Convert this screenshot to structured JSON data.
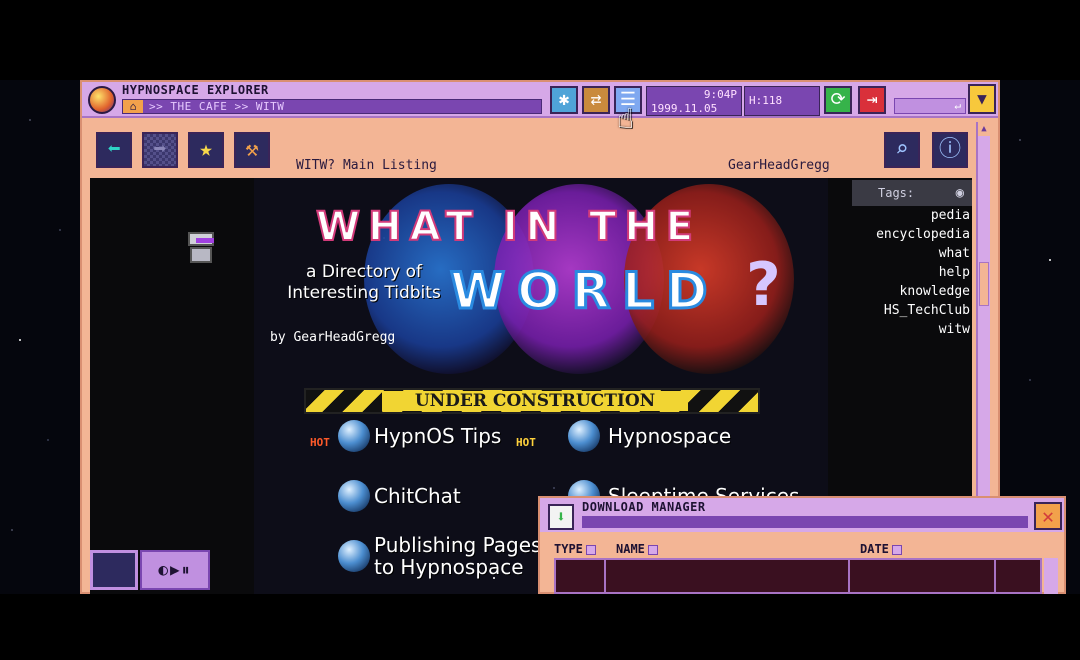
{
  "window": {
    "app_title": "HYPNOSPACE EXPLORER",
    "address": ">> THE CAFE >> WITW",
    "clock_time": "9:04P",
    "clock_date": "1999.11.05",
    "hypnocoin": "H:118"
  },
  "nav": {
    "page_title": "WITW? Main Listing",
    "page_author": "GearHeadGregg"
  },
  "page": {
    "logo_line1": [
      "W",
      "H",
      "A",
      "T",
      " ",
      "I",
      "N",
      " ",
      "T",
      "H",
      "E"
    ],
    "logo_line2": "WORLD",
    "logo_question": "?",
    "tagline": "a Directory of Interesting Tidbits",
    "byline": "by GearHeadGregg",
    "construction": "UNDER CONSTRUCTION",
    "links": [
      {
        "label": "HypnOS Tips",
        "badge": "HOT"
      },
      {
        "label": "Hypnospace",
        "badge": "HOT"
      },
      {
        "label": "ChitChat"
      },
      {
        "label": "Sleeptime Services"
      },
      {
        "label": "Publishing Pages to Hypnospace"
      }
    ]
  },
  "tags": {
    "header": "Tags:",
    "items": [
      "pedia",
      "encyclopedia",
      "what",
      "help",
      "knowledge",
      "HS_TechClub",
      "witw"
    ]
  },
  "download_manager": {
    "title": "DOWNLOAD MANAGER",
    "columns": {
      "type": "TYPE",
      "name": "NAME",
      "date": "DATE"
    }
  },
  "colors": {
    "window_peach": "#f3b595",
    "titlebar_lavender": "#d6a8e8",
    "address_purple": "#7a46b0",
    "construction_yellow": "#f1d533"
  }
}
